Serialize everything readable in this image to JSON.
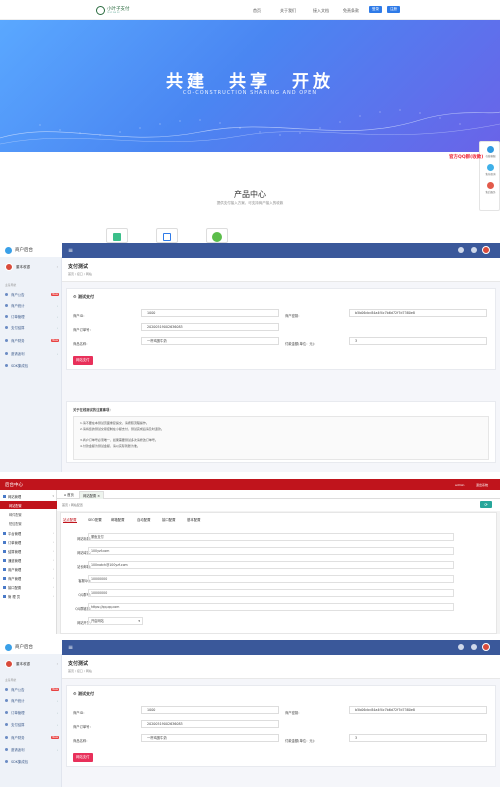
{
  "site": {
    "logo_text": "小叶子支付",
    "logo_sub": "YE ZI ZHI FU",
    "nav": [
      "首页",
      "关于我们",
      "接入文档",
      "免责条款"
    ],
    "btn_login": "登录",
    "btn_register": "注册",
    "hero_title": "共建　共享　开放",
    "hero_subtitle": "CO-CONSTRUCTION SHARING AND OPEN",
    "side_items": [
      "在线客服",
      "售前咨询",
      "售后服务"
    ],
    "kefu_label": "官方QQ群(收款)",
    "product_title": "产品中心",
    "product_subtitle": "提供支付接入方案，可支持商户接入的收款"
  },
  "admin": {
    "brand": "商户后台",
    "username": "董本收银",
    "section_label": "主菜导航",
    "menu": [
      {
        "label": "商户公告",
        "badge": "New"
      },
      {
        "label": "商户统计",
        "badge": ""
      },
      {
        "label": "订单管理",
        "badge": ""
      },
      {
        "label": "支付结算",
        "badge": ""
      },
      {
        "label": "商户财务",
        "badge": "New"
      },
      {
        "label": "邀请返利",
        "badge": ""
      },
      {
        "label": "SDK集成包",
        "badge": ""
      }
    ],
    "page_title": "支付测试",
    "breadcrumb": "首页 / 接口 / 网站",
    "card_title": "测试支付",
    "fields": {
      "merchant_id_label": "商户ID：",
      "merchant_id_value": "1000",
      "merchant_key_label": "商户密钥：",
      "merchant_key_value": "b5b06dcc84a4f4c7b6d72f7d7380e8",
      "order_label": "商户订单号：",
      "order_value": "20200519002636083",
      "product_label": "商品名称：",
      "product_value": "一杯鸡蛋牛奶",
      "amount_label": "付款金额(单位：元)：",
      "amount_value": "3"
    },
    "pay_button": "网站支付",
    "notice_title": "关于在线测试的注意事项：",
    "notice_lines": [
      "1.请不要在本测试页面重复提交，请按照流程操作。",
      "2.请将您的测试交易控制在小额支付，测试完成后请及时退款。",
      "3.商户订单号必须唯一，如果需要测试多次请修改订单号。",
      "4.付款金额为测试金额，请以实际到账为准。"
    ]
  },
  "admin2": {
    "title": "后台中心",
    "user": "admin",
    "logout": "退出系统",
    "menu": [
      {
        "label": "网站管理",
        "sub": false
      },
      {
        "label": "网站配置",
        "sub": true
      },
      {
        "label": "邮件配置",
        "sub": true
      },
      {
        "label": "短信配置",
        "sub": true
      },
      {
        "label": "平台管理",
        "sub": false
      },
      {
        "label": "订单管理",
        "sub": false
      },
      {
        "label": "结算管理",
        "sub": false
      },
      {
        "label": "通道管理",
        "sub": false
      },
      {
        "label": "用户管理",
        "sub": false
      },
      {
        "label": "商户管理",
        "sub": false
      },
      {
        "label": "接口配置",
        "sub": false
      },
      {
        "label": "管 理 员",
        "sub": false
      }
    ],
    "tabs": [
      "首页",
      "网站配置"
    ],
    "breadcrumb": "首页 / 网站配置",
    "subtabs": [
      "站点配置",
      "SEO配置",
      "邮箱配置",
      "自动配置",
      "接口配置",
      "基本配置"
    ],
    "fields": [
      {
        "label": "网站标题：",
        "value": "董鱼支付"
      },
      {
        "label": "网站域名：",
        "value": "100yzf.com"
      },
      {
        "label": "站长邮箱：",
        "value": "100notch@100yzf.com"
      },
      {
        "label": "客服QQ：",
        "value": "10000000"
      },
      {
        "label": "QQ群号：",
        "value": "10000000"
      },
      {
        "label": "QQ群链接：",
        "value": "https://qq.qq.com"
      },
      {
        "label": "网站开关：",
        "value": "开启网站"
      }
    ]
  }
}
